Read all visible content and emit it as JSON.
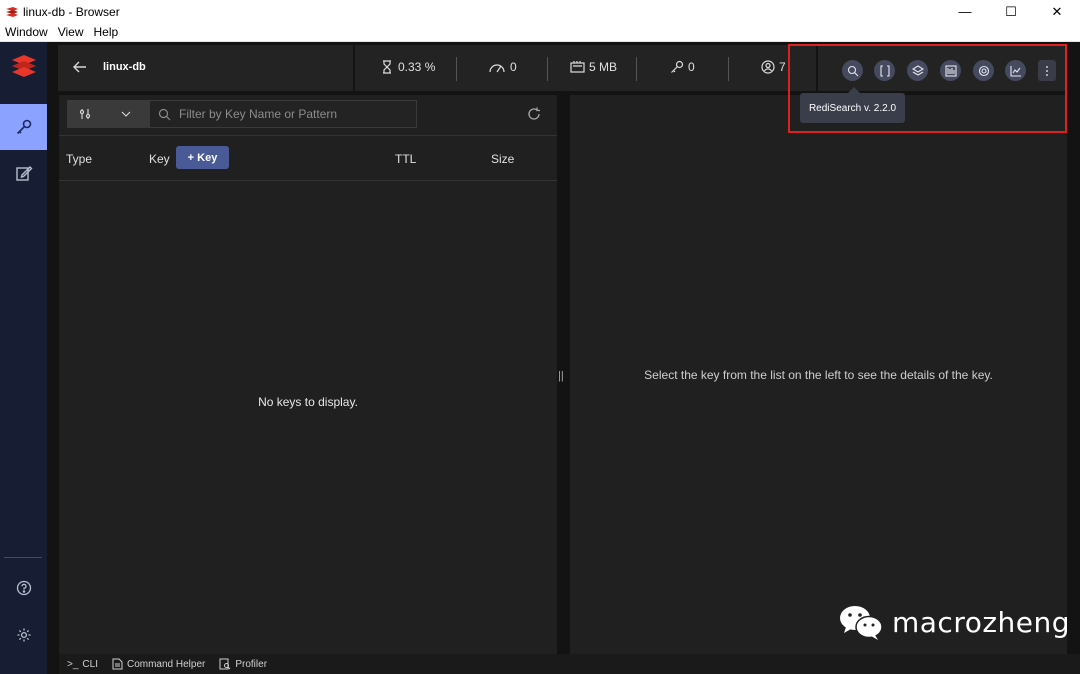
{
  "window": {
    "title": "linux-db - Browser",
    "minimize": "—",
    "maximize": "☐",
    "close": "✕"
  },
  "menu": [
    "Window",
    "View",
    "Help"
  ],
  "topbar": {
    "db_name": "linux-db",
    "stats": {
      "cpu": "0.33 %",
      "ops": "0",
      "memory": "5 MB",
      "keys": "0",
      "clients": "7"
    }
  },
  "toolbar": {
    "tooltip": "RediSearch v. 2.2.0",
    "modules": [
      "redisearch-icon",
      "redisjson-icon",
      "redisgraph-icon",
      "redistimeseries-icon",
      "redisgears-icon",
      "redisbloom-icon"
    ]
  },
  "filter": {
    "placeholder": "Filter by Key Name or Pattern"
  },
  "list": {
    "columns": {
      "type": "Type",
      "key": "Key",
      "ttl": "TTL",
      "size": "Size"
    },
    "add_key": "+ Key",
    "empty": "No keys to display."
  },
  "details": {
    "empty": "Select the key from the list on the left to see the details of the key."
  },
  "watermark": "macrozheng",
  "bottom": {
    "cli": "CLI",
    "cli_prefix": ">_",
    "helper": "Command Helper",
    "profiler": "Profiler"
  },
  "colors": {
    "accent": "#8ba2ff",
    "highlight": "#e02020",
    "nav_bg": "#171e33"
  }
}
